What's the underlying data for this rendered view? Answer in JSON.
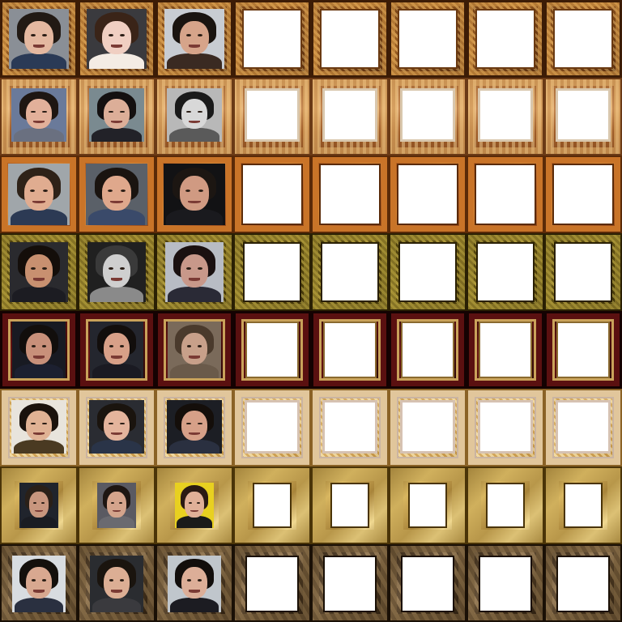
{
  "rows": [
    {
      "frame_style": "ornate-gold",
      "cells": [
        {
          "portrait": true,
          "tone": {
            "bg": "#8a8f96",
            "hair": "#221a14",
            "skin": "#e4b8a0",
            "shirt": "#2a3a56"
          }
        },
        {
          "portrait": true,
          "tone": {
            "bg": "#3a3a3e",
            "hair": "#3a2418",
            "skin": "#f0cfc2",
            "shirt": "#f4ece4"
          }
        },
        {
          "portrait": true,
          "tone": {
            "bg": "#c8ccd2",
            "hair": "#1a1410",
            "skin": "#d6a48a",
            "shirt": "#3a2a22"
          }
        },
        {
          "portrait": false
        },
        {
          "portrait": false
        },
        {
          "portrait": false
        },
        {
          "portrait": false
        },
        {
          "portrait": false
        }
      ]
    },
    {
      "frame_style": "baroque-light",
      "cells": [
        {
          "portrait": true,
          "tone": {
            "bg": "#6a7a9a",
            "hair": "#1e1612",
            "skin": "#e2b09a",
            "shirt": "#6a7080"
          }
        },
        {
          "portrait": true,
          "tone": {
            "bg": "#7a8a90",
            "hair": "#141010",
            "skin": "#dcae98",
            "shirt": "#222228"
          }
        },
        {
          "portrait": true,
          "tone": {
            "bg": "#b8b8b8",
            "hair": "#1a1a1a",
            "skin": "#d8d8d8",
            "shirt": "#5a5a5a"
          }
        },
        {
          "portrait": false
        },
        {
          "portrait": false
        },
        {
          "portrait": false
        },
        {
          "portrait": false
        },
        {
          "portrait": false
        }
      ]
    },
    {
      "frame_style": "orange-simple",
      "cells": [
        {
          "portrait": true,
          "tone": {
            "bg": "#a0a6aa",
            "hair": "#2e2218",
            "skin": "#e0ac90",
            "shirt": "#2c3a54"
          }
        },
        {
          "portrait": true,
          "tone": {
            "bg": "#5a6068",
            "hair": "#1a1410",
            "skin": "#dfa88c",
            "shirt": "#3a4a6a"
          }
        },
        {
          "portrait": true,
          "tone": {
            "bg": "#121214",
            "hair": "#1c1612",
            "skin": "#d09a82",
            "shirt": "#1a1a1e"
          }
        },
        {
          "portrait": false
        },
        {
          "portrait": false
        },
        {
          "portrait": false
        },
        {
          "portrait": false
        },
        {
          "portrait": false
        }
      ]
    },
    {
      "frame_style": "olive-ornate",
      "cells": [
        {
          "portrait": true,
          "tone": {
            "bg": "#2a2a2e",
            "hair": "#140e0a",
            "skin": "#c89070",
            "shirt": "#1c1c22"
          }
        },
        {
          "portrait": true,
          "tone": {
            "bg": "#202020",
            "hair": "#3a3a3a",
            "skin": "#cfcfcf",
            "shirt": "#8a8a8a"
          }
        },
        {
          "portrait": true,
          "tone": {
            "bg": "#b8bcc4",
            "hair": "#1a1010",
            "skin": "#c8988a",
            "shirt": "#2a2a36"
          }
        },
        {
          "portrait": false
        },
        {
          "portrait": false
        },
        {
          "portrait": false
        },
        {
          "portrait": false
        },
        {
          "portrait": false
        }
      ]
    },
    {
      "frame_style": "mahogany",
      "cells": [
        {
          "portrait": true,
          "tone": {
            "bg": "#181a22",
            "hair": "#120e0c",
            "skin": "#c8907a",
            "shirt": "#1c2030"
          }
        },
        {
          "portrait": true,
          "tone": {
            "bg": "#24262e",
            "hair": "#120e0c",
            "skin": "#d8a088",
            "shirt": "#1a1a22"
          }
        },
        {
          "portrait": true,
          "tone": {
            "bg": "#7a6a5a",
            "hair": "#4a3a2c",
            "skin": "#c8a08a",
            "shirt": "#6a5a4a"
          }
        },
        {
          "portrait": false
        },
        {
          "portrait": false
        },
        {
          "portrait": false
        },
        {
          "portrait": false
        },
        {
          "portrait": false
        }
      ]
    },
    {
      "frame_style": "cream-gold",
      "cells": [
        {
          "portrait": true,
          "tone": {
            "bg": "#e8e4dc",
            "hair": "#1a120c",
            "skin": "#e0b294",
            "shirt": "#4a3a22"
          }
        },
        {
          "portrait": true,
          "tone": {
            "bg": "#2a2c32",
            "hair": "#1a140e",
            "skin": "#e4b49c",
            "shirt": "#2a3448"
          }
        },
        {
          "portrait": true,
          "tone": {
            "bg": "#1c1e24",
            "hair": "#140e0a",
            "skin": "#d6a088",
            "shirt": "#2a3040"
          }
        },
        {
          "portrait": false
        },
        {
          "portrait": false
        },
        {
          "portrait": false
        },
        {
          "portrait": false
        },
        {
          "portrait": false
        }
      ]
    },
    {
      "frame_style": "wide-gold",
      "cells": [
        {
          "portrait": true,
          "tone": {
            "bg": "#20242c",
            "hair": "#2a2018",
            "skin": "#c8967e",
            "shirt": "#1a1c22"
          }
        },
        {
          "portrait": true,
          "tone": {
            "bg": "#5a5a62",
            "hair": "#1e1612",
            "skin": "#d4a48c",
            "shirt": "#6a6a70"
          }
        },
        {
          "portrait": true,
          "tone": {
            "bg": "#e8d020",
            "hair": "#2a1a14",
            "skin": "#e0b098",
            "shirt": "#1a1a1a"
          }
        },
        {
          "portrait": false
        },
        {
          "portrait": false
        },
        {
          "portrait": false
        },
        {
          "portrait": false
        },
        {
          "portrait": false
        }
      ]
    },
    {
      "frame_style": "dark-wood",
      "cells": [
        {
          "portrait": true,
          "tone": {
            "bg": "#d8dce0",
            "hair": "#14100c",
            "skin": "#d8a890",
            "shirt": "#2a3040"
          }
        },
        {
          "portrait": true,
          "tone": {
            "bg": "#2a2c30",
            "hair": "#1a140e",
            "skin": "#dcae94",
            "shirt": "#3a3a3e"
          }
        },
        {
          "portrait": true,
          "tone": {
            "bg": "#c0c6cc",
            "hair": "#120e0c",
            "skin": "#dcae98",
            "shirt": "#1c1c22"
          }
        },
        {
          "portrait": false
        },
        {
          "portrait": false
        },
        {
          "portrait": false
        },
        {
          "portrait": false
        },
        {
          "portrait": false
        }
      ]
    }
  ]
}
